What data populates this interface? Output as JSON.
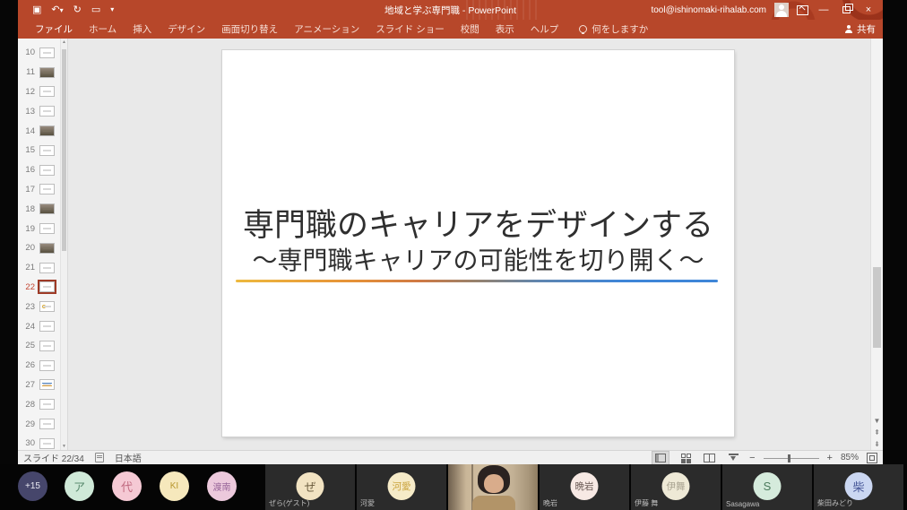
{
  "window": {
    "title": "地域と学ぶ専門職  -  PowerPoint",
    "account": "tool@ishinomaki-rihalab.com",
    "brand_color": "#b7472a",
    "quick_access_icons": [
      "save-icon",
      "undo-icon",
      "redo-icon",
      "start-from-beginning-icon",
      "customize-toolbar-icon"
    ]
  },
  "ribbon": {
    "tabs": [
      "ファイル",
      "ホーム",
      "挿入",
      "デザイン",
      "画面切り替え",
      "アニメーション",
      "スライド ショー",
      "校閲",
      "表示",
      "ヘルプ"
    ],
    "tell_me": "何をしますか",
    "share_label": "共有"
  },
  "thumbnail_panel": {
    "slides": [
      {
        "num": 10,
        "tone": "light",
        "selected": false
      },
      {
        "num": 11,
        "tone": "dark",
        "selected": false
      },
      {
        "num": 12,
        "tone": "light",
        "selected": false
      },
      {
        "num": 13,
        "tone": "light",
        "selected": false
      },
      {
        "num": 14,
        "tone": "dark",
        "selected": false
      },
      {
        "num": 15,
        "tone": "light",
        "selected": false
      },
      {
        "num": 16,
        "tone": "light",
        "selected": false
      },
      {
        "num": 17,
        "tone": "light",
        "selected": false
      },
      {
        "num": 18,
        "tone": "dark",
        "selected": false
      },
      {
        "num": 19,
        "tone": "light",
        "selected": false
      },
      {
        "num": 20,
        "tone": "dark",
        "selected": false
      },
      {
        "num": 21,
        "tone": "light",
        "selected": false
      },
      {
        "num": 22,
        "tone": "light",
        "selected": true
      },
      {
        "num": 23,
        "tone": "yellow",
        "selected": false
      },
      {
        "num": 24,
        "tone": "light",
        "selected": false
      },
      {
        "num": 25,
        "tone": "light",
        "selected": false
      },
      {
        "num": 26,
        "tone": "light",
        "selected": false
      },
      {
        "num": 27,
        "tone": "lines",
        "selected": false
      },
      {
        "num": 28,
        "tone": "light",
        "selected": false
      },
      {
        "num": 29,
        "tone": "light",
        "selected": false
      },
      {
        "num": 30,
        "tone": "light",
        "selected": false
      }
    ]
  },
  "slide": {
    "title": "専門職のキャリアをデザインする",
    "subtitle": "～専門職キャリアの可能性を切り開く～",
    "divider_colors": [
      "#edb93f 0%",
      "#e69238 24%",
      "#d07a44 38%",
      "#96826e 50%",
      "#5f86b0 63%",
      "#3f86d8 80%",
      "#3f86d8 100%"
    ]
  },
  "status_bar": {
    "slide_counter": "スライド 22/34",
    "language": "日本語",
    "zoom_level": "85%"
  },
  "participants": {
    "chips": [
      {
        "label": "+15",
        "bg": "#46466b",
        "fg": "#e9e9f2"
      },
      {
        "label": "ア",
        "bg": "#cfe9d8",
        "fg": "#5a8a6e"
      },
      {
        "label": "代",
        "bg": "#f5c9d4",
        "fg": "#c06a80"
      },
      {
        "label": "KI",
        "bg": "#f6e8bc",
        "fg": "#b8962e"
      },
      {
        "label": "渡南",
        "bg": "#ecc9dc",
        "fg": "#99669a"
      }
    ],
    "tiles": [
      {
        "initial": "ぜ",
        "name": "ぜら(ゲスト)",
        "bg": "#f2e3c2",
        "fg": "#6b5c3e",
        "video": false
      },
      {
        "initial": "河愛",
        "name": "河愛",
        "bg": "#f6ebc8",
        "fg": "#c9a23a",
        "video": false
      },
      {
        "initial": "",
        "name": "",
        "bg": "#2b2b2b",
        "fg": "#ffffff",
        "video": true
      },
      {
        "initial": "晩岩",
        "name": "晩岩",
        "bg": "#f7e9e4",
        "fg": "#6a5a55",
        "video": false
      },
      {
        "initial": "伊舞",
        "name": "伊藤 舞",
        "bg": "#eee9d6",
        "fg": "#a9a391",
        "video": false
      },
      {
        "initial": "S",
        "name": "Sasagawa",
        "bg": "#d5ebdc",
        "fg": "#4a7a5c",
        "video": false
      },
      {
        "initial": "柴",
        "name": "柴田みどり",
        "bg": "#cbd7f2",
        "fg": "#4a5a9a",
        "video": false
      }
    ]
  }
}
